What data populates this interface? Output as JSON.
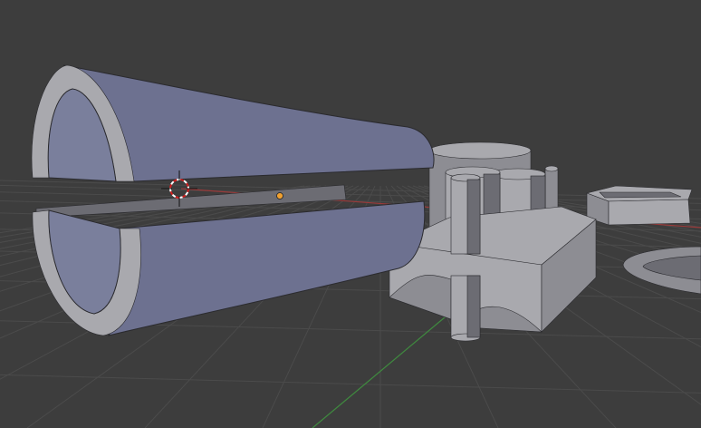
{
  "viewport": {
    "background": "#3d3d3d",
    "grid_color": "#4b4b4b",
    "x_axis_color": "#9a3a3a",
    "y_axis_color": "#3f8a3f"
  },
  "materials": {
    "mesh_face": "#8d8d93",
    "mesh_face_light": "#a9a9ae",
    "mesh_face_dark": "#6c6c73",
    "cylinder_inner": "#7a7f9c",
    "cylinder_outer": "#6d7190",
    "wire": "#2a2a2e"
  },
  "overlay": {
    "cursor_colors": [
      "#d21e1e",
      "#ffffff"
    ],
    "origin_color": "#f0a030"
  },
  "scene_objects": [
    "split-tube",
    "tall-cylinder",
    "block-with-pegs",
    "tray",
    "ring"
  ]
}
